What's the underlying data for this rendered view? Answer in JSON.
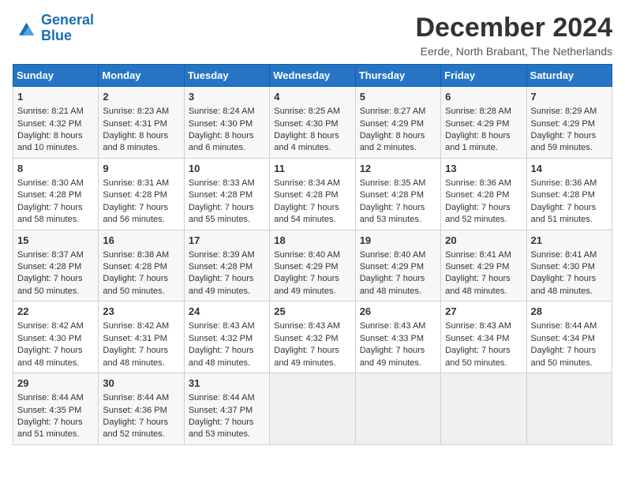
{
  "logo": {
    "line1": "General",
    "line2": "Blue"
  },
  "title": "December 2024",
  "subtitle": "Eerde, North Brabant, The Netherlands",
  "headers": [
    "Sunday",
    "Monday",
    "Tuesday",
    "Wednesday",
    "Thursday",
    "Friday",
    "Saturday"
  ],
  "weeks": [
    [
      {
        "day": "1",
        "sunrise": "8:21 AM",
        "sunset": "4:32 PM",
        "daylight": "8 hours and 10 minutes."
      },
      {
        "day": "2",
        "sunrise": "8:23 AM",
        "sunset": "4:31 PM",
        "daylight": "8 hours and 8 minutes."
      },
      {
        "day": "3",
        "sunrise": "8:24 AM",
        "sunset": "4:30 PM",
        "daylight": "8 hours and 6 minutes."
      },
      {
        "day": "4",
        "sunrise": "8:25 AM",
        "sunset": "4:30 PM",
        "daylight": "8 hours and 4 minutes."
      },
      {
        "day": "5",
        "sunrise": "8:27 AM",
        "sunset": "4:29 PM",
        "daylight": "8 hours and 2 minutes."
      },
      {
        "day": "6",
        "sunrise": "8:28 AM",
        "sunset": "4:29 PM",
        "daylight": "8 hours and 1 minute."
      },
      {
        "day": "7",
        "sunrise": "8:29 AM",
        "sunset": "4:29 PM",
        "daylight": "7 hours and 59 minutes."
      }
    ],
    [
      {
        "day": "8",
        "sunrise": "8:30 AM",
        "sunset": "4:28 PM",
        "daylight": "7 hours and 58 minutes."
      },
      {
        "day": "9",
        "sunrise": "8:31 AM",
        "sunset": "4:28 PM",
        "daylight": "7 hours and 56 minutes."
      },
      {
        "day": "10",
        "sunrise": "8:33 AM",
        "sunset": "4:28 PM",
        "daylight": "7 hours and 55 minutes."
      },
      {
        "day": "11",
        "sunrise": "8:34 AM",
        "sunset": "4:28 PM",
        "daylight": "7 hours and 54 minutes."
      },
      {
        "day": "12",
        "sunrise": "8:35 AM",
        "sunset": "4:28 PM",
        "daylight": "7 hours and 53 minutes."
      },
      {
        "day": "13",
        "sunrise": "8:36 AM",
        "sunset": "4:28 PM",
        "daylight": "7 hours and 52 minutes."
      },
      {
        "day": "14",
        "sunrise": "8:36 AM",
        "sunset": "4:28 PM",
        "daylight": "7 hours and 51 minutes."
      }
    ],
    [
      {
        "day": "15",
        "sunrise": "8:37 AM",
        "sunset": "4:28 PM",
        "daylight": "7 hours and 50 minutes."
      },
      {
        "day": "16",
        "sunrise": "8:38 AM",
        "sunset": "4:28 PM",
        "daylight": "7 hours and 50 minutes."
      },
      {
        "day": "17",
        "sunrise": "8:39 AM",
        "sunset": "4:28 PM",
        "daylight": "7 hours and 49 minutes."
      },
      {
        "day": "18",
        "sunrise": "8:40 AM",
        "sunset": "4:29 PM",
        "daylight": "7 hours and 49 minutes."
      },
      {
        "day": "19",
        "sunrise": "8:40 AM",
        "sunset": "4:29 PM",
        "daylight": "7 hours and 48 minutes."
      },
      {
        "day": "20",
        "sunrise": "8:41 AM",
        "sunset": "4:29 PM",
        "daylight": "7 hours and 48 minutes."
      },
      {
        "day": "21",
        "sunrise": "8:41 AM",
        "sunset": "4:30 PM",
        "daylight": "7 hours and 48 minutes."
      }
    ],
    [
      {
        "day": "22",
        "sunrise": "8:42 AM",
        "sunset": "4:30 PM",
        "daylight": "7 hours and 48 minutes."
      },
      {
        "day": "23",
        "sunrise": "8:42 AM",
        "sunset": "4:31 PM",
        "daylight": "7 hours and 48 minutes."
      },
      {
        "day": "24",
        "sunrise": "8:43 AM",
        "sunset": "4:32 PM",
        "daylight": "7 hours and 48 minutes."
      },
      {
        "day": "25",
        "sunrise": "8:43 AM",
        "sunset": "4:32 PM",
        "daylight": "7 hours and 49 minutes."
      },
      {
        "day": "26",
        "sunrise": "8:43 AM",
        "sunset": "4:33 PM",
        "daylight": "7 hours and 49 minutes."
      },
      {
        "day": "27",
        "sunrise": "8:43 AM",
        "sunset": "4:34 PM",
        "daylight": "7 hours and 50 minutes."
      },
      {
        "day": "28",
        "sunrise": "8:44 AM",
        "sunset": "4:34 PM",
        "daylight": "7 hours and 50 minutes."
      }
    ],
    [
      {
        "day": "29",
        "sunrise": "8:44 AM",
        "sunset": "4:35 PM",
        "daylight": "7 hours and 51 minutes."
      },
      {
        "day": "30",
        "sunrise": "8:44 AM",
        "sunset": "4:36 PM",
        "daylight": "7 hours and 52 minutes."
      },
      {
        "day": "31",
        "sunrise": "8:44 AM",
        "sunset": "4:37 PM",
        "daylight": "7 hours and 53 minutes."
      },
      null,
      null,
      null,
      null
    ]
  ]
}
